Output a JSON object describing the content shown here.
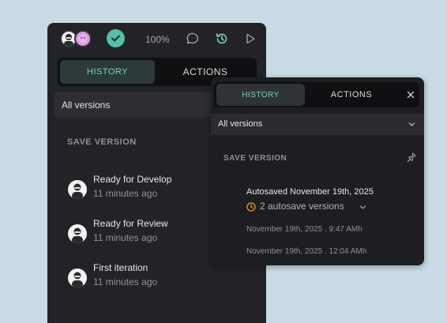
{
  "toolbar": {
    "zoom_label": "100%"
  },
  "history_panel": {
    "tabs": [
      {
        "label": "HISTORY",
        "active": true
      },
      {
        "label": "ACTIONS",
        "active": false
      }
    ],
    "filter_label": "All versions",
    "section_title": "SAVE VERSION",
    "versions": [
      {
        "title": "Ready for Develop",
        "time": "11 minutes ago"
      },
      {
        "title": "Ready for Review",
        "time": "11 minutes ago"
      },
      {
        "title": "First iteration",
        "time": "11 minutes ago"
      }
    ]
  },
  "popup_panel": {
    "tabs": [
      {
        "label": "HISTORY",
        "active": true
      },
      {
        "label": "ACTIONS",
        "active": false
      }
    ],
    "filter_label": "All versions",
    "section_title": "SAVE VERSION",
    "autosave": {
      "title": "Autosaved November 19th, 2025",
      "count_label": "2 autosave versions",
      "entries": [
        "November 19th, 2025 . 9:47 AMh",
        "November 19th, 2025 . 12:04 AMh"
      ]
    }
  },
  "colors": {
    "accent": "#78d3c4",
    "check_green": "#53c1aa",
    "clock_orange": "#f0962e",
    "background": "#c9dbe6"
  },
  "icons": [
    "check-icon",
    "comment-icon",
    "history-icon",
    "play-icon",
    "close-icon",
    "chevron-down-icon",
    "pin-icon",
    "clock-icon"
  ]
}
